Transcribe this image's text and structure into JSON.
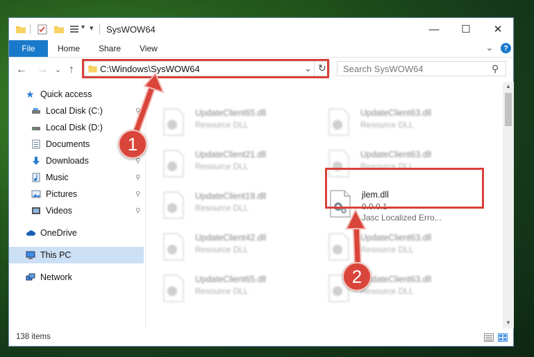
{
  "window": {
    "title": "SysWOW64",
    "minimize_glyph": "—",
    "maximize_glyph": "☐",
    "close_glyph": "✕"
  },
  "ribbon": {
    "tabs": [
      "File",
      "Home",
      "Share",
      "View"
    ],
    "expand_glyph": "⌄",
    "help_glyph": "?"
  },
  "navigation": {
    "back_glyph": "←",
    "forward_glyph": "→",
    "recent_glyph": "⌄",
    "up_glyph": "↑",
    "address_path": "C:\\Windows\\SysWOW64",
    "dropdown_glyph": "⌄",
    "refresh_glyph": "↻",
    "search_placeholder": "Search SysWOW64",
    "search_glyph": "⚲"
  },
  "sidebar": {
    "items": [
      {
        "label": "Quick access",
        "icon": "star-icon"
      },
      {
        "label": "Local Disk (C:)",
        "icon": "drive-icon"
      },
      {
        "label": "Local Disk (D:)",
        "icon": "drive-icon"
      },
      {
        "label": "Documents",
        "icon": "documents-icon"
      },
      {
        "label": "Downloads",
        "icon": "download-icon"
      },
      {
        "label": "Music",
        "icon": "music-icon"
      },
      {
        "label": "Pictures",
        "icon": "pictures-icon"
      },
      {
        "label": "Videos",
        "icon": "videos-icon"
      },
      {
        "label": "OneDrive",
        "icon": "cloud-icon"
      },
      {
        "label": "This PC",
        "icon": "computer-icon"
      },
      {
        "label": "Network",
        "icon": "network-icon"
      }
    ],
    "pin_glyph": "📌",
    "selected": "This PC"
  },
  "files": [
    {
      "name": "UpdateClient65.dll",
      "desc": "Resource DLL"
    },
    {
      "name": "UpdateClient63.dll",
      "desc": "Resource DLL"
    },
    {
      "name": "UpdateClient21.dll",
      "desc": "Resource DLL"
    },
    {
      "name": "UpdateClient63.dll",
      "desc": "Resource DLL"
    },
    {
      "name": "UpdateClient19.dll",
      "desc": "Resource DLL"
    },
    {
      "name": "jlem.dll",
      "version": "9.0.0.1",
      "desc": "Jasc Localized Erro..."
    },
    {
      "name": "UpdateClient42.dll",
      "desc": "Resource DLL"
    },
    {
      "name": "UpdateClient63.dll",
      "desc": "Resource DLL"
    },
    {
      "name": "UpdateClient65.dll",
      "desc": "Resource DLL"
    },
    {
      "name": "UpdateClient63.dll",
      "desc": "Resource DLL"
    }
  ],
  "status": {
    "item_count": "138 items"
  },
  "annotations": {
    "badge_1": "1",
    "badge_2": "2",
    "color": "#d8413a"
  }
}
